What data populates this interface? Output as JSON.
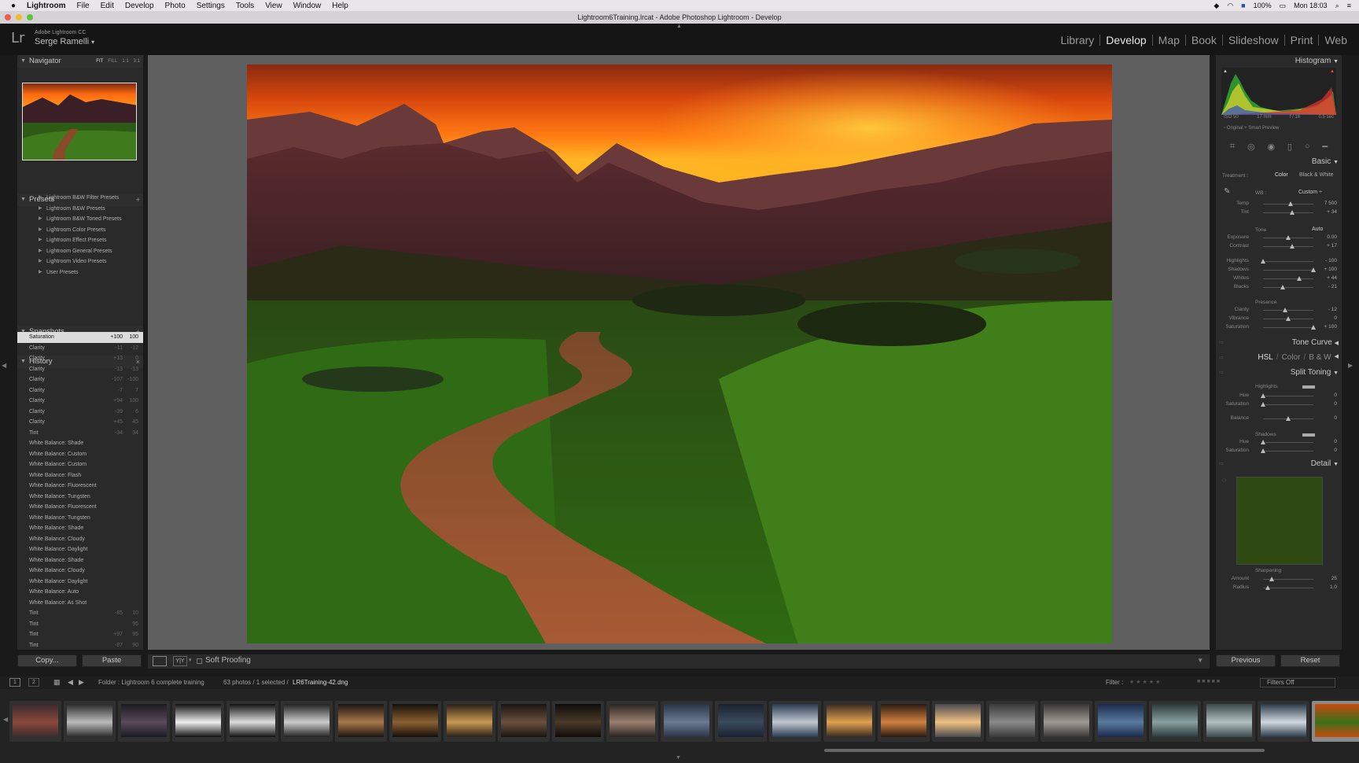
{
  "menubar": {
    "apple": "",
    "items": [
      "Lightroom",
      "File",
      "Edit",
      "Develop",
      "Photo",
      "Settings",
      "Tools",
      "View",
      "Window",
      "Help"
    ],
    "battery": "100%",
    "clock": "Mon 18:03"
  },
  "window": {
    "title": "Lightroom6Training.lrcat - Adobe Photoshop Lightroom - Develop"
  },
  "identity": {
    "logo": "Lr",
    "product": "Adobe Lightroom CC",
    "user": "Serge Ramelli",
    "user_arrow": "▾"
  },
  "modules": [
    "Library",
    "Develop",
    "Map",
    "Book",
    "Slideshow",
    "Print",
    "Web"
  ],
  "active_module": "Develop",
  "navigator": {
    "title": "Navigator",
    "zoom_options": [
      "FIT",
      "FILL",
      "1:1",
      "3:1"
    ]
  },
  "presets": {
    "title": "Presets",
    "add": "+",
    "items": [
      "Lightroom B&W Filter Presets",
      "Lightroom B&W Presets",
      "Lightroom B&W Toned Presets",
      "Lightroom Color Presets",
      "Lightroom Effect Presets",
      "Lightroom General Presets",
      "Lightroom Video Presets",
      "User Presets"
    ]
  },
  "snapshots": {
    "title": "Snapshots",
    "add": "+"
  },
  "history": {
    "title": "History",
    "clear": "×",
    "items": [
      {
        "label": "Saturation",
        "v1": "+100",
        "v2": "100"
      },
      {
        "label": "Clarity",
        "v1": "-11",
        "v2": "-12"
      },
      {
        "label": "Clarity",
        "v1": "+13",
        "v2": "0"
      },
      {
        "label": "Clarity",
        "v1": "-13",
        "v2": "-13"
      },
      {
        "label": "Clarity",
        "v1": "-107",
        "v2": "-100"
      },
      {
        "label": "Clarity",
        "v1": "-7",
        "v2": "7"
      },
      {
        "label": "Clarity",
        "v1": "+94",
        "v2": "100"
      },
      {
        "label": "Clarity",
        "v1": "-39",
        "v2": "6"
      },
      {
        "label": "Clarity",
        "v1": "+45",
        "v2": "45"
      },
      {
        "label": "Tint",
        "v1": "-34",
        "v2": "34"
      },
      {
        "label": "White Balance: Shade",
        "v1": "",
        "v2": ""
      },
      {
        "label": "White Balance: Custom",
        "v1": "",
        "v2": ""
      },
      {
        "label": "White Balance: Custom",
        "v1": "",
        "v2": ""
      },
      {
        "label": "White Balance: Flash",
        "v1": "",
        "v2": ""
      },
      {
        "label": "White Balance: Fluorescent",
        "v1": "",
        "v2": ""
      },
      {
        "label": "White Balance: Tungsten",
        "v1": "",
        "v2": ""
      },
      {
        "label": "White Balance: Fluorescent",
        "v1": "",
        "v2": ""
      },
      {
        "label": "White Balance: Tungsten",
        "v1": "",
        "v2": ""
      },
      {
        "label": "White Balance: Shade",
        "v1": "",
        "v2": ""
      },
      {
        "label": "White Balance: Cloudy",
        "v1": "",
        "v2": ""
      },
      {
        "label": "White Balance: Daylight",
        "v1": "",
        "v2": ""
      },
      {
        "label": "White Balance: Shade",
        "v1": "",
        "v2": ""
      },
      {
        "label": "White Balance: Cloudy",
        "v1": "",
        "v2": ""
      },
      {
        "label": "White Balance: Daylight",
        "v1": "",
        "v2": ""
      },
      {
        "label": "White Balance: Auto",
        "v1": "",
        "v2": ""
      },
      {
        "label": "White Balance: As Shot",
        "v1": "",
        "v2": ""
      },
      {
        "label": "Tint",
        "v1": "-85",
        "v2": "10"
      },
      {
        "label": "Tint",
        "v1": "",
        "v2": "95"
      },
      {
        "label": "Tint",
        "v1": "+97",
        "v2": "95"
      },
      {
        "label": "Tint",
        "v1": "-87",
        "v2": "90"
      }
    ]
  },
  "left_buttons": {
    "copy": "Copy...",
    "paste": "Paste"
  },
  "toolbar": {
    "soft_proofing": "Soft Proofing"
  },
  "histogram": {
    "title": "Histogram",
    "iso": "ISO 50",
    "focal": "17 mm",
    "aperture": "f / 16",
    "shutter": "0.5 sec",
    "preview": "Original + Smart Preview"
  },
  "basic": {
    "title": "Basic",
    "treatment_label": "Treatment :",
    "treatment_color": "Color",
    "treatment_bw": "Black & White",
    "wb_label": "WB :",
    "wb_value": "Custom",
    "tone_label": "Tone",
    "tone_auto": "Auto",
    "presence_label": "Presence",
    "sliders": [
      {
        "label": "Temp",
        "value": "7 500",
        "pos": 0.55
      },
      {
        "label": "Tint",
        "value": "+ 34",
        "pos": 0.58
      },
      {
        "label": "Exposure",
        "value": "0.00",
        "pos": 0.5
      },
      {
        "label": "Contrast",
        "value": "+ 17",
        "pos": 0.58
      },
      {
        "label": "Highlights",
        "value": "- 100",
        "pos": 0.0
      },
      {
        "label": "Shadows",
        "value": "+ 100",
        "pos": 1.0
      },
      {
        "label": "Whites",
        "value": "+ 44",
        "pos": 0.72
      },
      {
        "label": "Blacks",
        "value": "- 21",
        "pos": 0.39
      },
      {
        "label": "Clarity",
        "value": "- 12",
        "pos": 0.44
      },
      {
        "label": "Vibrance",
        "value": "0",
        "pos": 0.5
      },
      {
        "label": "Saturation",
        "value": "+ 100",
        "pos": 1.0
      }
    ]
  },
  "tone_curve": {
    "title": "Tone Curve"
  },
  "hsl": {
    "hsl": "HSL",
    "color": "Color",
    "bw": "B & W",
    "sep": "/"
  },
  "split_toning": {
    "title": "Split Toning",
    "highlights": "Highlights",
    "shadows": "Shadows",
    "sliders": [
      {
        "label": "Hue",
        "value": "0",
        "pos": 0.0
      },
      {
        "label": "Saturation",
        "value": "0",
        "pos": 0.0
      },
      {
        "label": "Balance",
        "value": "0",
        "pos": 0.5
      },
      {
        "label": "Hue",
        "value": "0",
        "pos": 0.0
      },
      {
        "label": "Saturation",
        "value": "0",
        "pos": 0.0
      }
    ]
  },
  "detail": {
    "title": "Detail",
    "sharpening": "Sharpening",
    "sliders": [
      {
        "label": "Amount",
        "value": "25",
        "pos": 0.17
      },
      {
        "label": "Radius",
        "value": "1.0",
        "pos": 0.1
      }
    ]
  },
  "right_buttons": {
    "previous": "Previous",
    "reset": "Reset"
  },
  "filmbar": {
    "page1": "1",
    "page2": "2",
    "folder": "Folder : Lightroom 6 complete training",
    "count": "63 photos / 1 selected /",
    "filename": "LR6Training-42.dng",
    "filter_label": "Filter :",
    "filter_value": "Filters Off"
  },
  "colors": {
    "accent": "#dcdcdc",
    "panel": "#2a2a2a",
    "background": "#1a1a1a",
    "center": "#5f5f5f"
  }
}
